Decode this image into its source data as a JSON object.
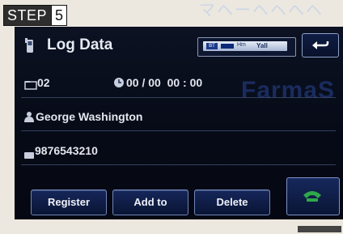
{
  "step": {
    "label": "STEP",
    "number": "5"
  },
  "header": {
    "title": "Log Data"
  },
  "status": {
    "bt": "BT",
    "hm": "Hm",
    "signal": "Yall"
  },
  "fields": {
    "counter": "02",
    "datetime": "00 / 00  00 : 00",
    "name": "George Washington",
    "phone": "9876543210"
  },
  "buttons": {
    "register": "Register",
    "add_to": "Add to",
    "delete": "Delete"
  },
  "watermark": "FarmaS",
  "top_faint": "マヘーヘヘヘヘ",
  "colors": {
    "screen_bg": "#060a16",
    "button_border": "#6f84b8",
    "call_green": "#2ea84a",
    "text": "#e3e6ee"
  },
  "icons": [
    "phone-handset-icon",
    "status-icon",
    "back-arrow-icon",
    "folder-icon",
    "clock-icon",
    "person-icon",
    "phone-number-icon",
    "call-icon"
  ]
}
